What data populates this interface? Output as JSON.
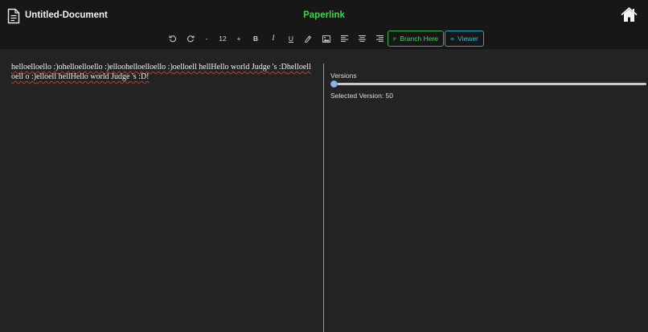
{
  "header": {
    "doc_title": "Untitled-Document",
    "brand": "Paperlink",
    "brand_color": "#3fcf4a",
    "doc_icon": "document-icon",
    "home_icon": "home-icon"
  },
  "toolbar": {
    "undo_icon": "undo-icon",
    "redo_icon": "redo-icon",
    "decrease_label": "-",
    "font_size": "12",
    "increase_label": "+",
    "bold_label": "B",
    "italic_label": "I",
    "underline_label": "U",
    "highlight_icon": "highlighter-icon",
    "image_icon": "image-icon",
    "align_left_icon": "align-left-icon",
    "align_center_icon": "align-center-icon",
    "align_right_icon": "align-right-icon",
    "branch_label": "Branch Here",
    "branch_icon": "branch-icon",
    "viewer_label": "Viewer",
    "viewer_icon": "eye-icon",
    "branch_color": "#36b54a",
    "viewer_color": "#27a6c6"
  },
  "editor": {
    "segments": [
      "helloelloello :)",
      "ohelloelloello :)",
      "elloohelloelloello :)",
      "oelloell hellHello world Judge 's :D",
      "helloelloell o :)",
      "elloell hellHello world Judge 's :D!"
    ]
  },
  "versions": {
    "label": "Versions",
    "selected_text": "Selected Version: 50",
    "selected_value": 50,
    "slider_fraction": 0.0
  }
}
